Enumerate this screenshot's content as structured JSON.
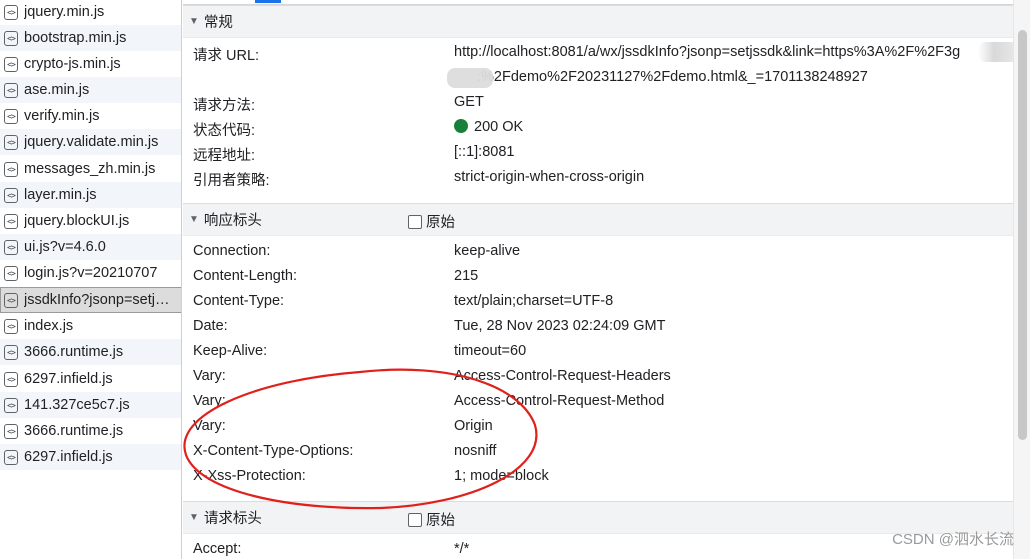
{
  "files": [
    {
      "name": "jquery.min.js"
    },
    {
      "name": "bootstrap.min.js"
    },
    {
      "name": "crypto-js.min.js"
    },
    {
      "name": "ase.min.js"
    },
    {
      "name": "verify.min.js"
    },
    {
      "name": "jquery.validate.min.js"
    },
    {
      "name": "messages_zh.min.js"
    },
    {
      "name": "layer.min.js"
    },
    {
      "name": "jquery.blockUI.js"
    },
    {
      "name": "ui.js?v=4.6.0"
    },
    {
      "name": "login.js?v=20210707"
    },
    {
      "name": "jssdkInfo?jsonp=setj…",
      "selected": true
    },
    {
      "name": "index.js"
    },
    {
      "name": "3666.runtime.js"
    },
    {
      "name": "6297.infield.js"
    },
    {
      "name": "141.327ce5c7.js"
    },
    {
      "name": "3666.runtime.js"
    },
    {
      "name": "6297.infield.js"
    }
  ],
  "file_icon": "script-file-icon",
  "general": {
    "title": "常规",
    "request_url_label": "请求 URL:",
    "request_url_line1": "http://localhost:8081/a/wx/jssdkInfo?jsonp=setjssdk&link=https%3A%2F%2F3g",
    "request_url_line2": ":%2Fdemo%2F20231127%2Fdemo.html&_=1701138248927",
    "method_label": "请求方法:",
    "method_value": "GET",
    "status_label": "状态代码:",
    "status_value": "200 OK",
    "status_color": "#188038",
    "remote_label": "远程地址:",
    "remote_value": "[::1]:8081",
    "referrer_label": "引用者策略:",
    "referrer_value": "strict-origin-when-cross-origin"
  },
  "response_headers": {
    "title": "响应标头",
    "raw_label": "原始",
    "rows": [
      {
        "key": "Connection:",
        "value": "keep-alive"
      },
      {
        "key": "Content-Length:",
        "value": "215"
      },
      {
        "key": "Content-Type:",
        "value": "text/plain;charset=UTF-8"
      },
      {
        "key": "Date:",
        "value": "Tue, 28 Nov 2023 02:24:09 GMT"
      },
      {
        "key": "Keep-Alive:",
        "value": "timeout=60"
      },
      {
        "key": "Vary:",
        "value": "Access-Control-Request-Headers"
      },
      {
        "key": "Vary:",
        "value": "Access-Control-Request-Method"
      },
      {
        "key": "Vary:",
        "value": "Origin"
      },
      {
        "key": "X-Content-Type-Options:",
        "value": "nosniff"
      },
      {
        "key": "X-Xss-Protection:",
        "value": "1; mode=block"
      }
    ]
  },
  "request_headers": {
    "title": "请求标头",
    "raw_label": "原始",
    "rows": [
      {
        "key": "Accept:",
        "value": "*/*"
      }
    ]
  },
  "annotation_color": "#e0201b",
  "watermark": "CSDN @泗水长流"
}
